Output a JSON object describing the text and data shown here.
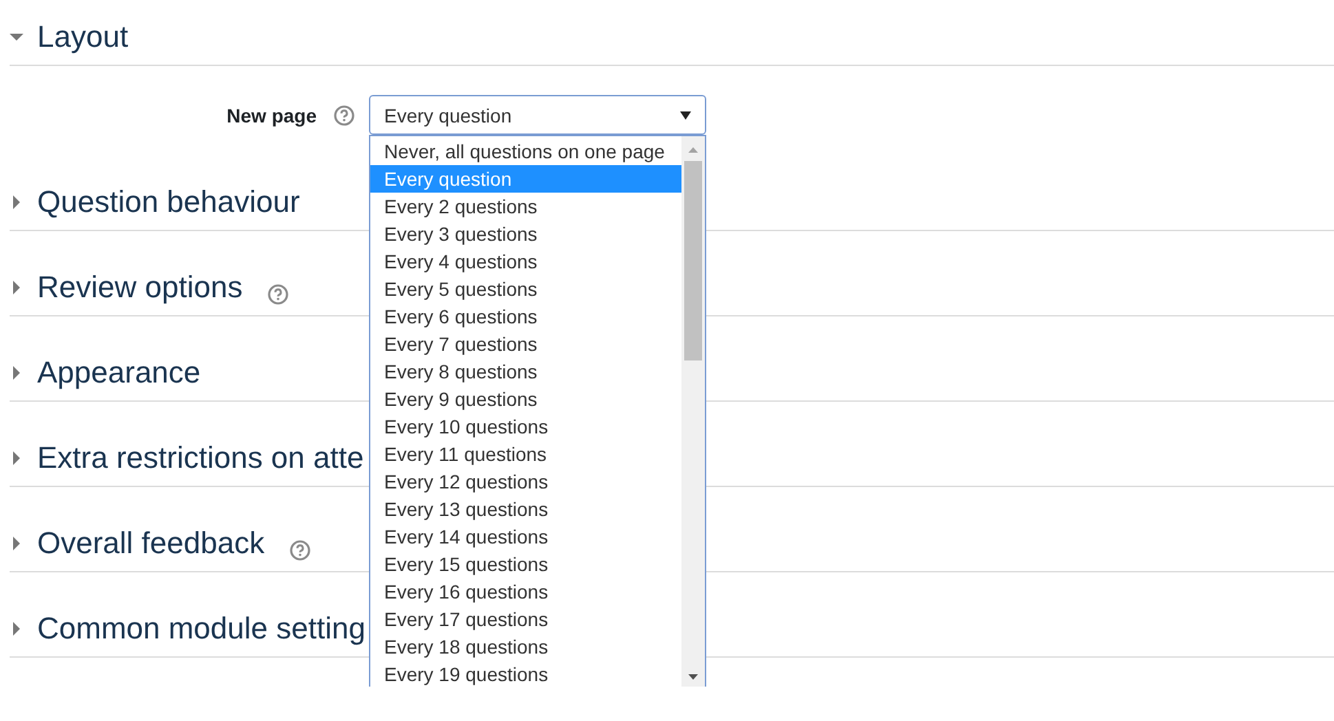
{
  "sections": [
    {
      "title": "Layout",
      "expanded": true,
      "help": false,
      "fields": [
        {
          "label": "New page",
          "help": true,
          "value": "Every question",
          "dropdown_open": true,
          "options": [
            {
              "label": "Never, all questions on one page",
              "selected": false
            },
            {
              "label": "Every question",
              "selected": true
            },
            {
              "label": "Every 2 questions",
              "selected": false
            },
            {
              "label": "Every 3 questions",
              "selected": false
            },
            {
              "label": "Every 4 questions",
              "selected": false
            },
            {
              "label": "Every 5 questions",
              "selected": false
            },
            {
              "label": "Every 6 questions",
              "selected": false
            },
            {
              "label": "Every 7 questions",
              "selected": false
            },
            {
              "label": "Every 8 questions",
              "selected": false
            },
            {
              "label": "Every 9 questions",
              "selected": false
            },
            {
              "label": "Every 10 questions",
              "selected": false
            },
            {
              "label": "Every 11 questions",
              "selected": false
            },
            {
              "label": "Every 12 questions",
              "selected": false
            },
            {
              "label": "Every 13 questions",
              "selected": false
            },
            {
              "label": "Every 14 questions",
              "selected": false
            },
            {
              "label": "Every 15 questions",
              "selected": false
            },
            {
              "label": "Every 16 questions",
              "selected": false
            },
            {
              "label": "Every 17 questions",
              "selected": false
            },
            {
              "label": "Every 18 questions",
              "selected": false
            },
            {
              "label": "Every 19 questions",
              "selected": false
            }
          ]
        }
      ]
    },
    {
      "title": "Question behaviour",
      "expanded": false,
      "help": false
    },
    {
      "title": "Review options",
      "expanded": false,
      "help": true
    },
    {
      "title": "Appearance",
      "expanded": false,
      "help": false
    },
    {
      "title": "Extra restrictions on atte",
      "expanded": false,
      "help": false
    },
    {
      "title": "Overall feedback",
      "expanded": false,
      "help": true
    },
    {
      "title": "Common module setting",
      "expanded": false,
      "help": false
    }
  ]
}
